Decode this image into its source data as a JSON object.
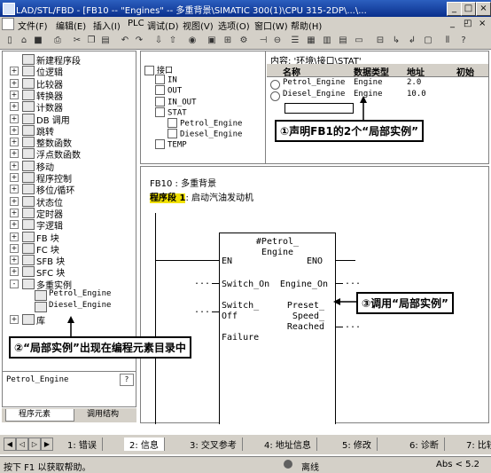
{
  "window": {
    "title": "LAD/STL/FBD  - [FB10 -- \"Engines\" -- 多重背景\\SIMATIC 300(1)\\CPU 315-2DP\\...\\...",
    "min_label": "_",
    "max_label": "□",
    "close_label": "×",
    "inner_min": "_",
    "inner_max": "◰",
    "inner_close": "×"
  },
  "menu": [
    "文件(F)",
    "编辑(E)",
    "插入(I)",
    "PLC",
    "调试(D)",
    "视图(V)",
    "选项(O)",
    "窗口(W)",
    "帮助(H)"
  ],
  "sidebar": {
    "items": [
      {
        "label": "新建程序段",
        "expander": ""
      },
      {
        "label": "位逻辑",
        "expander": "+"
      },
      {
        "label": "比较器",
        "expander": "+"
      },
      {
        "label": "转换器",
        "expander": "+"
      },
      {
        "label": "计数器",
        "expander": "+"
      },
      {
        "label": "DB 调用",
        "expander": "+"
      },
      {
        "label": "跳转",
        "expander": "+"
      },
      {
        "label": "整数函数",
        "expander": "+"
      },
      {
        "label": "浮点数函数",
        "expander": "+"
      },
      {
        "label": "移动",
        "expander": "+"
      },
      {
        "label": "程序控制",
        "expander": "+"
      },
      {
        "label": "移位/循环",
        "expander": "+"
      },
      {
        "label": "状态位",
        "expander": "+"
      },
      {
        "label": "定时器",
        "expander": "+"
      },
      {
        "label": "字逻辑",
        "expander": "+"
      },
      {
        "label": "FB 块",
        "expander": "+"
      },
      {
        "label": "FC 块",
        "expander": "+"
      },
      {
        "label": "SFB 块",
        "expander": "+"
      },
      {
        "label": "SFC 块",
        "expander": "+"
      },
      {
        "label": "多重实例",
        "expander": "-"
      },
      {
        "label": "Petrol_Engine",
        "expander": ""
      },
      {
        "label": "Diesel_Engine",
        "expander": ""
      },
      {
        "label": "库",
        "expander": "+"
      }
    ],
    "info_text": "Petrol_Engine",
    "tabs": [
      "程序元素",
      "调用结构"
    ]
  },
  "interface": {
    "tree": [
      "接口",
      "IN",
      "OUT",
      "IN_OUT",
      "STAT",
      "Petrol_Engine",
      "Diesel_Engine",
      "TEMP"
    ],
    "content_label": "内容:  '环境\\接口\\STAT'",
    "columns": [
      "名称",
      "数据类型",
      "地址",
      "初始"
    ],
    "rows": [
      {
        "name": "Petrol_Engine",
        "type": "Engine",
        "address": "2.0"
      },
      {
        "name": "Diesel_Engine",
        "type": "Engine",
        "address": "10.0"
      }
    ]
  },
  "editor": {
    "block_title": "FB10 : 多重背景",
    "network_label": "程序段 1",
    "network_comment": ": 启动汽油发动机",
    "fb_instance_line1": "#Petrol_",
    "fb_instance_line2": "Engine",
    "pins": {
      "en": "EN",
      "eno": "ENO",
      "switch_on": "Switch_On",
      "engine_on": "Engine_On",
      "switch_off_1": "Switch_",
      "switch_off_2": "Off",
      "failure": "Failure",
      "preset_1": "Preset_",
      "preset_2": "Speed_",
      "preset_3": "Reached"
    },
    "dots": "...",
    "dots_short": "..."
  },
  "callouts": {
    "c1": "①声明FB1的2个“局部实例”",
    "c2": "②“局部实例”出现在编程元素目录中",
    "c3": "③调用“局部实例”"
  },
  "bottom_tabs": [
    "1: 错误",
    "2: 信息",
    "3: 交叉参考",
    "4: 地址信息",
    "5: 修改",
    "6: 诊断",
    "7: 比较"
  ],
  "status": {
    "help": "按下 F1 以获取帮助。",
    "mode": "离线",
    "abs": "Abs < 5.2"
  },
  "colors": {
    "titlebar": "#0a2f8c",
    "chrome": "#d4d0c8",
    "network_highlight": "#f0e000"
  }
}
